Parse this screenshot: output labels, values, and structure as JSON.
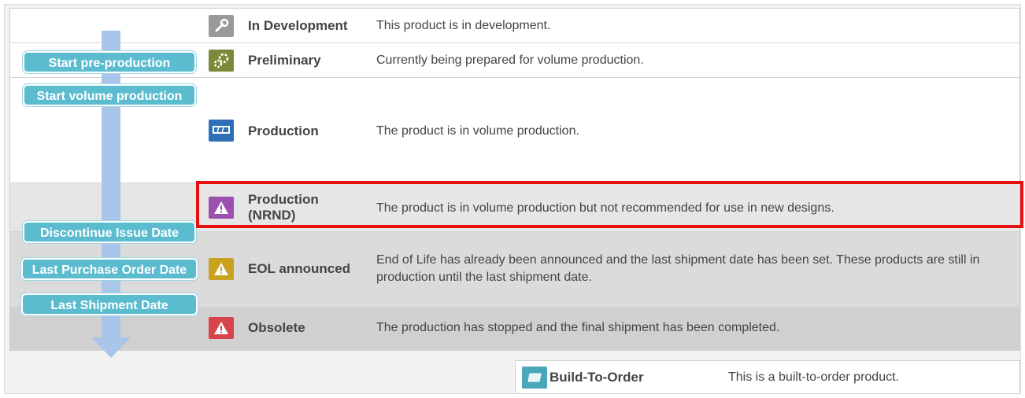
{
  "milestones": {
    "start_pre_production": "Start pre-production",
    "start_volume_production": "Start volume production",
    "discontinue_issue_date": "Discontinue Issue Date",
    "last_purchase_order_date": "Last Purchase Order Date",
    "last_shipment_date": "Last Shipment Date"
  },
  "statuses": [
    {
      "name": "In Development",
      "description": "This product is in development.",
      "icon": "wrench-icon",
      "icon_color": "#9a9a9a"
    },
    {
      "name": "Preliminary",
      "description": "Currently being prepared for volume production.",
      "icon": "gears-icon",
      "icon_color": "#7a8a3a"
    },
    {
      "name": "Production",
      "description": "The product is in volume production.",
      "icon": "production-icon",
      "icon_color": "#2f6fb8"
    },
    {
      "name": "Production (NRND)",
      "description": "The product is in volume production but not recommended for use in new designs.",
      "icon": "warning-icon",
      "icon_color": "#9b4fb0"
    },
    {
      "name": "EOL announced",
      "description": "End of Life has already been announced and the last shipment date has been set. These products are still in production until the last shipment date.",
      "icon": "warning-icon",
      "icon_color": "#c9a21f"
    },
    {
      "name": "Obsolete",
      "description": "The production has stopped and the final shipment has been completed.",
      "icon": "warning-icon",
      "icon_color": "#d9434a"
    }
  ],
  "build_to_order": {
    "name": "Build-To-Order",
    "description": "This is a built-to-order product.",
    "icon": "build-to-order-icon",
    "icon_color": "#4aa6b8"
  },
  "colors": {
    "highlight": "#e8100f",
    "arrow": "#a9c6ea",
    "milestone": "#5bbccf"
  }
}
